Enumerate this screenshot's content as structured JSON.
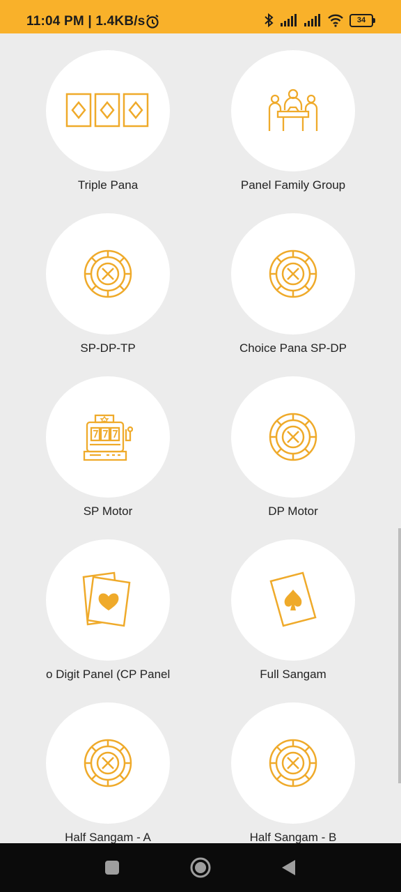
{
  "status_bar": {
    "text": "11:04 PM | 1.4KB/s",
    "battery": "34",
    "icons": [
      "alarm-icon",
      "bluetooth-icon",
      "signal-icon",
      "signal-icon",
      "wifi-icon",
      "battery-icon"
    ]
  },
  "colors": {
    "accent": "#f9b12a",
    "icon": "#efaa2a",
    "background": "#ececec",
    "tile": "#ffffff"
  },
  "games": [
    {
      "label": "Triple Pana",
      "icon": "cards-diamond-icon"
    },
    {
      "label": "Panel Family Group",
      "icon": "family-group-icon"
    },
    {
      "label": "SP-DP-TP",
      "icon": "roulette-wheel-icon"
    },
    {
      "label": "Choice Pana SP-DP",
      "icon": "roulette-wheel-icon"
    },
    {
      "label": "SP Motor",
      "icon": "slot-machine-icon"
    },
    {
      "label": "DP Motor",
      "icon": "roulette-wheel-icon"
    },
    {
      "label": "o Digit Panel (CP Panel",
      "icon": "heart-cards-icon"
    },
    {
      "label": "Full Sangam",
      "icon": "spade-card-icon"
    },
    {
      "label": "Half Sangam - A",
      "icon": "roulette-wheel-icon"
    },
    {
      "label": "Half Sangam - B",
      "icon": "roulette-wheel-icon"
    }
  ],
  "nav": {
    "buttons": [
      "recents-button",
      "home-button",
      "back-button"
    ]
  }
}
